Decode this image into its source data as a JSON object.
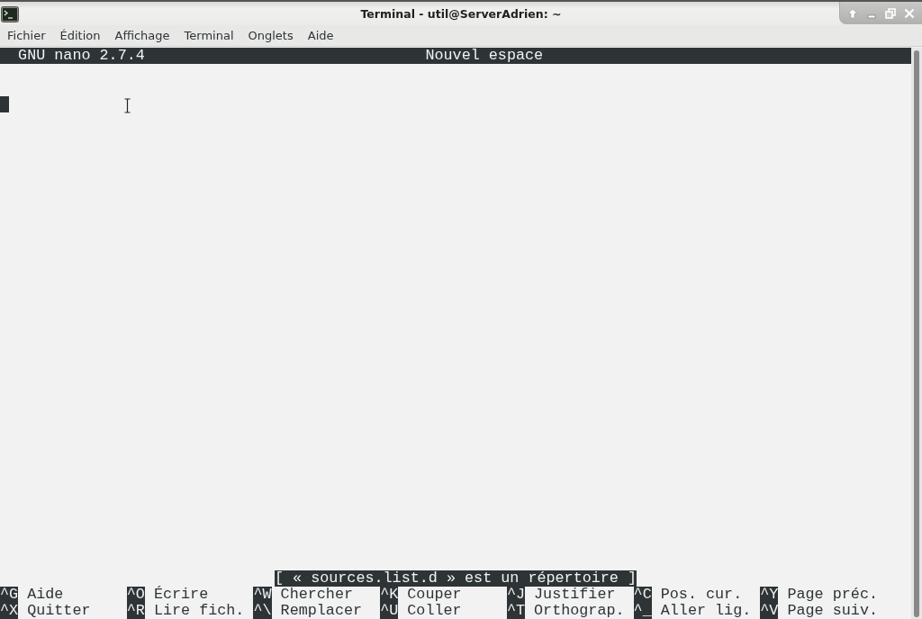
{
  "window": {
    "title": "Terminal - util@ServerAdrien: ~"
  },
  "menu": [
    "Fichier",
    "Édition",
    "Affichage",
    "Terminal",
    "Onglets",
    "Aide"
  ],
  "nano": {
    "version_label": "GNU nano 2.7.4",
    "file_title": "Nouvel espace",
    "status_message": "[ « sources.list.d » est un répertoire ]",
    "shortcut_rows": [
      [
        {
          "key": "^G",
          "label": "Aide"
        },
        {
          "key": "^O",
          "label": "Écrire"
        },
        {
          "key": "^W",
          "label": "Chercher"
        },
        {
          "key": "^K",
          "label": "Couper"
        },
        {
          "key": "^J",
          "label": "Justifier"
        },
        {
          "key": "^C",
          "label": "Pos. cur."
        },
        {
          "key": "^Y",
          "label": "Page préc."
        }
      ],
      [
        {
          "key": "^X",
          "label": "Quitter"
        },
        {
          "key": "^R",
          "label": "Lire fich."
        },
        {
          "key": "^\\",
          "label": "Remplacer"
        },
        {
          "key": "^U",
          "label": "Coller"
        },
        {
          "key": "^T",
          "label": "Orthograp."
        },
        {
          "key": "^_",
          "label": "Aller lig."
        },
        {
          "key": "^V",
          "label": "Page suiv."
        }
      ]
    ]
  }
}
